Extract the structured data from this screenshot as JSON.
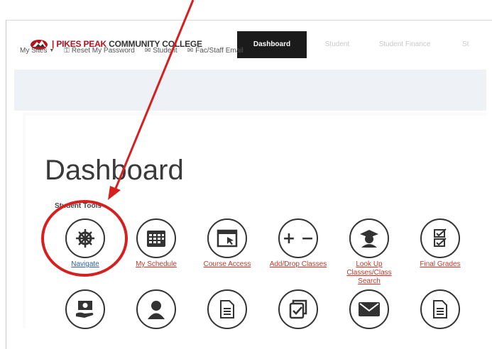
{
  "header": {
    "logo_prefix": "|",
    "logo_brand": "PIKES PEAK",
    "logo_rest": "COMMUNITY COLLEGE",
    "tabs": [
      {
        "label": "Dashboard",
        "active": true
      },
      {
        "label": "Student",
        "active": false
      },
      {
        "label": "Student Finance",
        "active": false
      },
      {
        "label": "St",
        "active": false
      }
    ]
  },
  "subnav": {
    "my_sites": "My Sites",
    "reset_password": "Reset My Password",
    "student": "Student",
    "fac_staff_email": "Fac/Staff Email"
  },
  "main": {
    "page_title": "Dashboard",
    "section_label": "Student Tools",
    "tools_row1": [
      {
        "label": "Navigate",
        "icon": "ship-wheel-icon"
      },
      {
        "label": "My Schedule",
        "icon": "calendar-icon"
      },
      {
        "label": "Course Access",
        "icon": "browser-cursor-icon"
      },
      {
        "label": "Add/Drop Classes",
        "icon": "plus-minus-icon"
      },
      {
        "label": "Look Up Classes/Class Search",
        "icon": "student-icon"
      },
      {
        "label": "Final Grades",
        "icon": "checklist-icon"
      }
    ],
    "tools_row2": [
      {
        "label": "",
        "icon": "money-hand-icon"
      },
      {
        "label": "",
        "icon": "person-icon"
      },
      {
        "label": "",
        "icon": "document-icon"
      },
      {
        "label": "",
        "icon": "signed-document-icon"
      },
      {
        "label": "",
        "icon": "envelope-icon"
      },
      {
        "label": "",
        "icon": "document-icon"
      }
    ]
  },
  "colors": {
    "brand_red": "#b5121b",
    "annotation_red": "#d62020",
    "active_tab_bg": "#1b1b1b"
  }
}
